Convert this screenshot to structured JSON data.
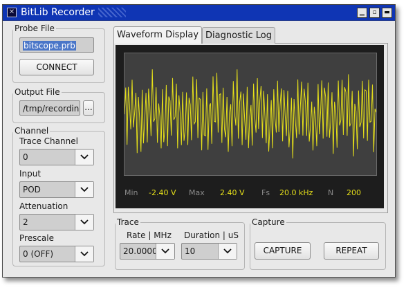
{
  "window": {
    "title": "BitLib Recorder"
  },
  "probe_file": {
    "legend": "Probe File",
    "value": "bitscope.prb",
    "connect_label": "CONNECT"
  },
  "output_file": {
    "legend": "Output File",
    "value": "/tmp/recording.",
    "browse_label": "..."
  },
  "channel": {
    "legend": "Channel",
    "trace_channel_label": "Trace Channel",
    "trace_channel_value": "0",
    "input_label": "Input",
    "input_value": "POD",
    "attenuation_label": "Attenuation",
    "attenuation_value": "2",
    "prescale_label": "Prescale",
    "prescale_value": "0 (OFF)"
  },
  "tabs": [
    {
      "label": "Waveform Display"
    },
    {
      "label": "Diagnostic Log"
    }
  ],
  "scope": {
    "trace_color": "#e6e01a",
    "min_label": "Min",
    "min_value": "-2.40  V",
    "max_label": "Max",
    "max_value": "2.40  V",
    "fs_label": "Fs",
    "fs_value": "20.0 kHz",
    "n_label": "N",
    "n_value": "200"
  },
  "trace": {
    "legend": "Trace",
    "rate_label": "Rate | MHz",
    "rate_value": "20.0000",
    "duration_label": "Duration | uS",
    "duration_value": "10"
  },
  "capture": {
    "legend": "Capture",
    "capture_label": "CAPTURE",
    "repeat_label": "REPEAT"
  }
}
